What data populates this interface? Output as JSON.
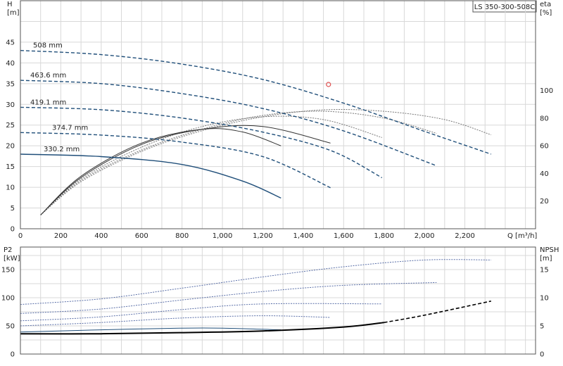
{
  "chart_data": [
    {
      "type": "line",
      "title": "LS 350-300-508C",
      "xlabel": "Q [m³/h]",
      "ylabel_left": [
        "H",
        "[m]"
      ],
      "ylabel_right": [
        "eta",
        "[%]"
      ],
      "xlim": [
        0,
        2550
      ],
      "ylim_left": [
        0,
        55
      ],
      "ylim_right": [
        0,
        165
      ],
      "x_ticks": [
        "0",
        "200",
        "400",
        "600",
        "800",
        "1,000",
        "1,200",
        "1,400",
        "1,600",
        "1,800",
        "2,000",
        "2,200"
      ],
      "y_ticks_left": [
        "0",
        "5",
        "10",
        "15",
        "20",
        "25",
        "30",
        "35",
        "40",
        "45"
      ],
      "y_ticks_right": [
        "20",
        "40",
        "60",
        "80",
        "100"
      ],
      "grid": true,
      "head_curves": [
        {
          "label": "508 mm",
          "style": "dashed",
          "x": [
            0,
            400,
            800,
            1200,
            1600,
            2000,
            2330
          ],
          "y": [
            43,
            42,
            39.7,
            36,
            30.3,
            23.5,
            18
          ]
        },
        {
          "label": "463.6 mm",
          "style": "dashed",
          "x": [
            0,
            400,
            800,
            1200,
            1600,
            2060
          ],
          "y": [
            35.8,
            35,
            32.6,
            29,
            23.6,
            15.2
          ]
        },
        {
          "label": "419.1 mm",
          "style": "dashed",
          "x": [
            0,
            400,
            800,
            1200,
            1540,
            1790
          ],
          "y": [
            29.3,
            28.7,
            26.7,
            23.3,
            18.8,
            12.3
          ]
        },
        {
          "label": "374.7 mm",
          "style": "dashed",
          "x": [
            0,
            400,
            800,
            1200,
            1535
          ],
          "y": [
            23.2,
            22.6,
            20.9,
            17.4,
            9.9
          ]
        },
        {
          "label": "330.2 mm",
          "style": "solid",
          "x": [
            0,
            400,
            800,
            1100,
            1290
          ],
          "y": [
            18,
            17.4,
            15.5,
            11.5,
            7.4
          ]
        }
      ],
      "efficiency_curves": [
        {
          "x": [
            100,
            300,
            600,
            900,
            1200,
            1500,
            1800,
            2100,
            2330
          ],
          "y": [
            10,
            34,
            56,
            71,
            81,
            86,
            85,
            79,
            68
          ]
        },
        {
          "x": [
            100,
            300,
            600,
            900,
            1200,
            1500,
            1800,
            2060
          ],
          "y": [
            10,
            35,
            57,
            72,
            82,
            85,
            80,
            69
          ]
        },
        {
          "x": [
            100,
            300,
            600,
            900,
            1200,
            1500,
            1790
          ],
          "y": [
            10,
            36,
            59,
            74,
            81,
            79,
            66
          ]
        },
        {
          "x": [
            100,
            300,
            600,
            900,
            1200,
            1535
          ],
          "y": [
            10,
            37,
            61,
            72,
            74,
            62
          ]
        },
        {
          "x": [
            100,
            300,
            600,
            900,
            1100,
            1290
          ],
          "y": [
            10,
            38,
            62,
            72,
            70,
            60
          ]
        }
      ],
      "duty_point": {
        "x": 1525,
        "y": 34.8,
        "marker": "circle",
        "color": "#e05050"
      }
    },
    {
      "type": "line",
      "xlim": [
        0,
        2550
      ],
      "ylabel_left": [
        "P2",
        "[kW]"
      ],
      "ylabel_right": [
        "NPSH",
        "[m]"
      ],
      "ylim_left": [
        0,
        190
      ],
      "ylim_right": [
        0,
        19
      ],
      "y_ticks_left": [
        "0",
        "50",
        "100",
        "150"
      ],
      "y_ticks_right": [
        "0",
        "5",
        "10",
        "15"
      ],
      "grid": true,
      "power_curves": [
        {
          "x": [
            0,
            400,
            800,
            1200,
            1600,
            2000,
            2330
          ],
          "y": [
            88,
            98,
            117,
            137,
            155,
            167,
            167
          ]
        },
        {
          "x": [
            0,
            400,
            800,
            1200,
            1600,
            2060
          ],
          "y": [
            72,
            80,
            96,
            111,
            122,
            127
          ]
        },
        {
          "x": [
            0,
            400,
            800,
            1200,
            1790
          ],
          "y": [
            59,
            66,
            79,
            89,
            89
          ]
        },
        {
          "x": [
            0,
            400,
            800,
            1200,
            1535
          ],
          "y": [
            50,
            56,
            64,
            68,
            65
          ]
        },
        {
          "x": [
            0,
            400,
            800,
            1000,
            1290
          ],
          "y": [
            39,
            43,
            46,
            46,
            43
          ]
        }
      ],
      "npsh_curve": {
        "x": [
          0,
          400,
          800,
          1200,
          1600,
          1800,
          2000,
          2330
        ],
        "y": [
          3.6,
          3.6,
          3.8,
          4.1,
          4.8,
          5.6,
          6.9,
          9.4
        ]
      }
    }
  ]
}
